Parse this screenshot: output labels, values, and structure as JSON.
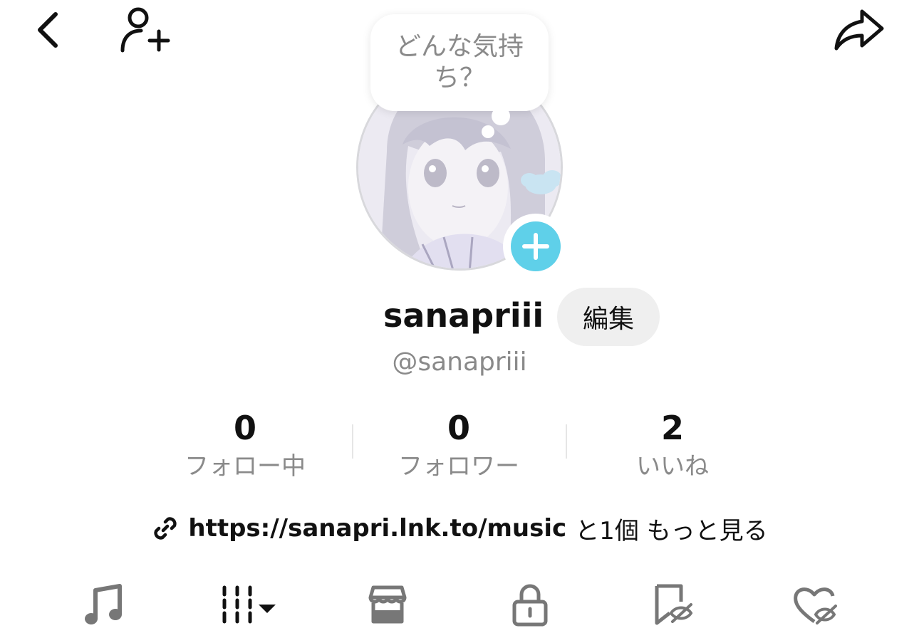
{
  "header": {
    "back_icon": "chevron-left-icon",
    "add_friend_icon": "person-plus-icon",
    "share_icon": "share-arrow-icon"
  },
  "mood_bubble": {
    "text": "どんな気持ち？"
  },
  "profile": {
    "username": "sanapriii",
    "handle": "@sanapriii",
    "edit_label": "編集",
    "accent_color": "#5fd0e9"
  },
  "stats": [
    {
      "value": "0",
      "label": "フォロー中"
    },
    {
      "value": "0",
      "label": "フォロワー"
    },
    {
      "value": "2",
      "label": "いいね"
    }
  ],
  "bio_link": {
    "url": "https://sanapri.lnk.to/music",
    "more": "と1個 もっと見る"
  },
  "tabs": [
    {
      "icon": "music-note-icon"
    },
    {
      "icon": "grid-columns-icon"
    },
    {
      "icon": "shop-icon"
    },
    {
      "icon": "lock-icon"
    },
    {
      "icon": "bookmark-hidden-icon"
    },
    {
      "icon": "heart-hidden-icon"
    }
  ]
}
